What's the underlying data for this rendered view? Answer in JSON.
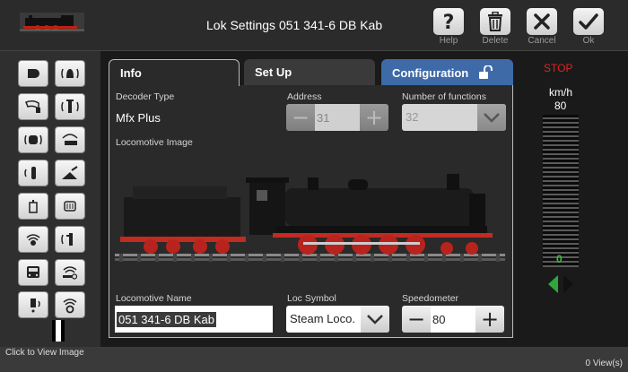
{
  "window": {
    "title": "Lok Settings 051 341-6 DB Kab"
  },
  "toolbar": {
    "help_label": "Help",
    "delete_label": "Delete",
    "cancel_label": "Cancel",
    "ok_label": "Ok"
  },
  "tabs": {
    "info": "Info",
    "setup": "Set Up",
    "configuration": "Configuration"
  },
  "info": {
    "decoder_type_label": "Decoder Type",
    "decoder_type_value": "Mfx Plus",
    "address_label": "Address",
    "address_value": "31",
    "num_functions_label": "Number of functions",
    "num_functions_value": "32",
    "loco_image_label": "Locomotive Image",
    "loco_name_label": "Locomotive Name",
    "loco_name_value": "051 341-6 DB Kab",
    "loco_symbol_label": "Loc Symbol",
    "loco_symbol_value": "Steam Loco.",
    "speedometer_label": "Speedometer",
    "speedometer_value": "80"
  },
  "speed": {
    "stop_label": "STOP",
    "unit": "km/h",
    "max_value": "80",
    "current_value": "0"
  },
  "status": {
    "hint": "Click to View Image",
    "views": "0 View(s)"
  },
  "colors": {
    "config_tab": "#3e6aa8",
    "stop": "#dd2222",
    "speed_zero": "#3fbf3f",
    "direction_left": "#2ea83a"
  },
  "function_icons": [
    "light-icon",
    "bell-icon",
    "horn-icon",
    "smoke-generator-icon",
    "cab-light-icon",
    "shunting-sound-icon",
    "whistle-icon",
    "telex-coupler-icon",
    "fuel-sound-icon",
    "track-sound-icon",
    "compressor-icon",
    "water-pump-icon",
    "bus-icon",
    "coupler-sound-icon",
    "door-sound-icon",
    "brake-sound-icon"
  ]
}
